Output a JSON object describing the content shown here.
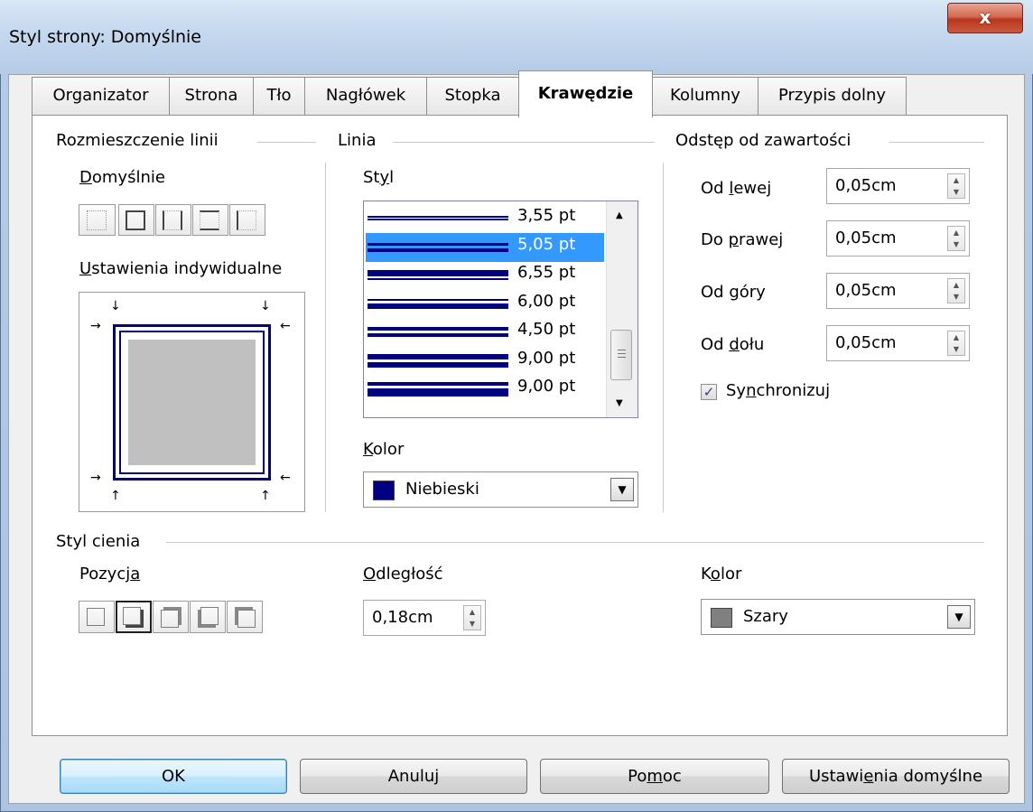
{
  "window": {
    "title": "Styl strony: Domyślnie",
    "close_label": "x"
  },
  "tabs": [
    {
      "label": "Organizator"
    },
    {
      "label": "Strona"
    },
    {
      "label": "Tło"
    },
    {
      "label": "Nagłówek"
    },
    {
      "label": "Stopka"
    },
    {
      "label": "Krawędzie",
      "active": true
    },
    {
      "label": "Kolumny"
    },
    {
      "label": "Przypis dolny"
    }
  ],
  "line_arrangement": {
    "title": "Rozmieszczenie linii",
    "default_label_u": "D",
    "default_label_rest": "omyślnie",
    "individual_label_u": "U",
    "individual_label_rest": "stawienia indywidualne"
  },
  "line": {
    "title": "Linia",
    "style_label_pre": "St",
    "style_label_u": "y",
    "style_label_post": "l",
    "styles": [
      {
        "value": "3,55 pt",
        "lines": [
          2,
          1,
          2
        ]
      },
      {
        "value": "5,05 pt",
        "lines": [
          3,
          3,
          4
        ],
        "selected": true
      },
      {
        "value": "6,55 pt",
        "lines": [
          7,
          2,
          2
        ]
      },
      {
        "value": "6,00 pt",
        "lines": [
          2,
          3,
          6
        ]
      },
      {
        "value": "4,50 pt",
        "lines": [
          4,
          3,
          4
        ]
      },
      {
        "value": "9,00 pt",
        "lines": [
          6,
          3,
          6
        ]
      },
      {
        "value": "9,00 pt",
        "lines": [
          4,
          3,
          9
        ]
      }
    ],
    "color_label_u": "K",
    "color_label_rest": "olor",
    "color_value": "Niebieski",
    "color_hex": "#000080"
  },
  "spacing": {
    "title": "Odstęp od zawartości",
    "fields": [
      {
        "label_pre": "Od ",
        "label_u": "l",
        "label_post": "ewej",
        "value": "0,05cm"
      },
      {
        "label_pre": "Do ",
        "label_u": "p",
        "label_post": "rawej",
        "value": "0,05cm"
      },
      {
        "label_pre": "Od ",
        "label_u": "g",
        "label_post": "óry",
        "value": "0,05cm"
      },
      {
        "label_pre": "Od ",
        "label_u": "d",
        "label_post": "ołu",
        "value": "0,05cm"
      }
    ],
    "sync_pre": "Sy",
    "sync_u": "n",
    "sync_post": "chronizuj",
    "sync_checked": true
  },
  "shadow": {
    "title": "Styl cienia",
    "position_pre": "Pozycj",
    "position_u": "a",
    "distance_u": "O",
    "distance_rest": "dległość",
    "distance_value": "0,18cm",
    "color_pre": "K",
    "color_u": "o",
    "color_post": "lor",
    "color_value": "Szary",
    "color_hex": "#808080"
  },
  "buttons": {
    "ok": "OK",
    "cancel": "Anuluj",
    "help_pre": "Po",
    "help_u": "m",
    "help_post": "oc",
    "reset_pre": "Ustawi",
    "reset_u": "e",
    "reset_post": "nia domyślne"
  },
  "colors": {
    "border_navy": "#000080",
    "selection": "#3399ff"
  }
}
